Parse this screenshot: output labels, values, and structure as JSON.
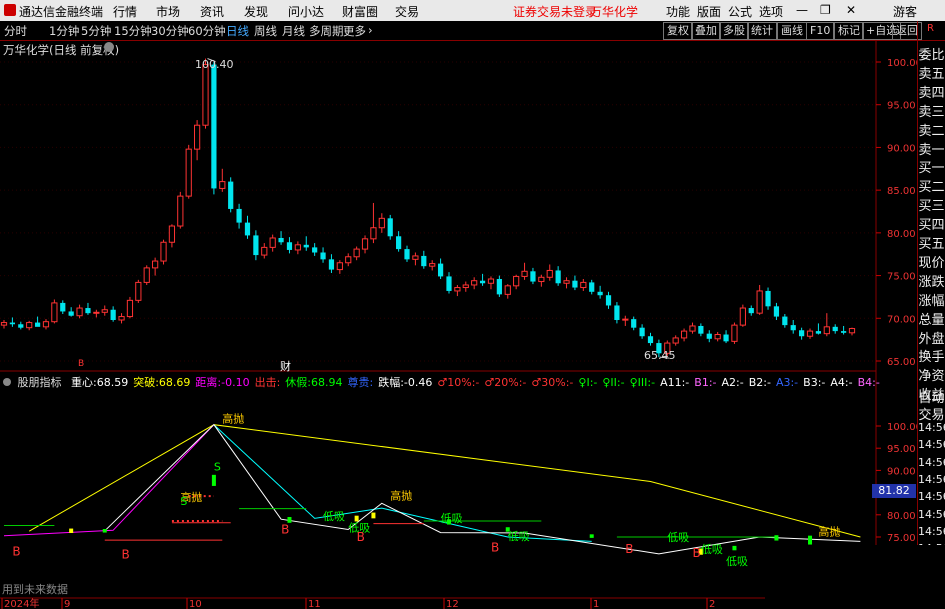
{
  "titlebar": {
    "app_name": "通达信金融终端",
    "menus": [
      "行情",
      "市场",
      "资讯",
      "发现",
      "问小达",
      "财富圈",
      "交易"
    ],
    "login_notice": "证券交易未登录",
    "stock_name": "万华化学",
    "right_menus": [
      "功能",
      "版面",
      "公式",
      "选项"
    ],
    "guest": "游客"
  },
  "tabbar": {
    "periods": [
      "分时",
      "1分钟",
      "5分钟",
      "15分钟",
      "30分钟",
      "60分钟",
      "日线",
      "周线",
      "月线",
      "多周期",
      "更多"
    ],
    "active_period": "日线",
    "buttons": [
      "复权",
      "叠加",
      "多股",
      "统计",
      "画线",
      "F10",
      "标记",
      "+自选",
      "返回"
    ]
  },
  "main_chart": {
    "title": "万华化学(日线 前复权)",
    "high_label": "100.40",
    "low_label": "65.45",
    "marker_cai": "财",
    "marker_b": "B"
  },
  "sub_chart": {
    "title": "股朋指标",
    "fields": [
      {
        "label": "重心:",
        "value": "68.59",
        "color": "#ffffff"
      },
      {
        "label": "突破:",
        "value": "68.69",
        "color": "#ffff00"
      },
      {
        "label": "距离:",
        "value": "-0.10",
        "color": "#ff00ff"
      },
      {
        "label": "出击:",
        "value": "",
        "color": "#ff3333"
      },
      {
        "label": "休假:",
        "value": "68.94",
        "color": "#00ff00"
      },
      {
        "label": "尊贵:",
        "value": "",
        "color": "#3366ff"
      },
      {
        "label": "跌幅:",
        "value": "-0.46",
        "color": "#ffffff"
      },
      {
        "label": "♂10%:",
        "value": "-",
        "color": "#ff3333"
      },
      {
        "label": "♂20%:",
        "value": "-",
        "color": "#ff3333"
      },
      {
        "label": "♂30%:",
        "value": "-",
        "color": "#ff3333"
      },
      {
        "label": "♀I:",
        "value": "-",
        "color": "#00ff00"
      },
      {
        "label": "♀II:",
        "value": "-",
        "color": "#00ff00"
      },
      {
        "label": "♀III:",
        "value": "-",
        "color": "#00ff00"
      },
      {
        "label": "A11:",
        "value": "-",
        "color": "#ffffff"
      },
      {
        "label": "B1:",
        "value": "-",
        "color": "#ff66ff"
      },
      {
        "label": "A2:",
        "value": "-",
        "color": "#ffffff"
      },
      {
        "label": "B2:",
        "value": "-",
        "color": "#ffffff"
      },
      {
        "label": "A3:",
        "value": "-",
        "color": "#3366ff"
      },
      {
        "label": "B3:",
        "value": "-",
        "color": "#ffffff"
      },
      {
        "label": "A4:",
        "value": "-",
        "color": "#ffffff"
      },
      {
        "label": "B4:",
        "value": "-",
        "color": "#ff66ff"
      }
    ],
    "current_value": "81.82",
    "footer_note": "用到未来数据",
    "annotations": {
      "high_sell": "高抛",
      "low_buy": "低吸",
      "buy": "B",
      "sell": "S"
    }
  },
  "right_panel": {
    "items": [
      "委比",
      "卖五",
      "卖四",
      "卖三",
      "卖二",
      "卖一",
      "买一",
      "买二",
      "买三",
      "买四",
      "买五",
      "现价",
      "涨跌",
      "涨幅",
      "总量",
      "外盘",
      "换手",
      "净资",
      "收益"
    ],
    "lower_items": [
      "自动",
      "交易"
    ],
    "times": [
      "14:56",
      "14:56",
      "14:56",
      "14:56",
      "14:56",
      "14:56",
      "14:56",
      "14:56",
      "14:56",
      "14:56"
    ],
    "top_badge": "R"
  },
  "chart_data": [
    {
      "type": "candlestick",
      "title": "万华化学(日线 前复权)",
      "ylim": [
        64,
        101
      ],
      "y_ticks": [
        65.0,
        70.0,
        75.0,
        80.0,
        85.0,
        90.0,
        95.0,
        100.0
      ],
      "annotated_high": 100.4,
      "annotated_low": 65.45,
      "ohlc": [
        [
          69.2,
          69.8,
          68.8,
          69.5
        ],
        [
          69.5,
          70.1,
          69.0,
          69.3
        ],
        [
          69.3,
          69.6,
          68.7,
          68.9
        ],
        [
          68.9,
          69.7,
          68.6,
          69.5
        ],
        [
          69.5,
          70.2,
          69.1,
          69.0
        ],
        [
          69.0,
          69.9,
          68.7,
          69.6
        ],
        [
          69.6,
          72.2,
          69.4,
          71.8
        ],
        [
          71.8,
          72.1,
          70.5,
          70.8
        ],
        [
          70.8,
          71.3,
          70.2,
          70.3
        ],
        [
          70.3,
          71.6,
          70.0,
          71.2
        ],
        [
          71.2,
          71.8,
          70.4,
          70.6
        ],
        [
          70.6,
          71.0,
          70.1,
          70.7
        ],
        [
          70.7,
          71.5,
          70.3,
          71.0
        ],
        [
          71.0,
          71.4,
          69.6,
          69.8
        ],
        [
          69.8,
          70.6,
          69.4,
          70.2
        ],
        [
          70.2,
          72.5,
          70.0,
          72.1
        ],
        [
          72.1,
          74.5,
          71.8,
          74.2
        ],
        [
          74.2,
          76.2,
          73.9,
          75.9
        ],
        [
          75.9,
          77.1,
          75.0,
          76.7
        ],
        [
          76.7,
          79.2,
          76.3,
          78.9
        ],
        [
          78.9,
          81.0,
          78.3,
          80.8
        ],
        [
          80.8,
          84.8,
          80.5,
          84.3
        ],
        [
          84.3,
          90.3,
          84.0,
          89.8
        ],
        [
          89.8,
          93.2,
          88.5,
          92.6
        ],
        [
          92.6,
          100.4,
          92.2,
          99.7
        ],
        [
          99.7,
          100.0,
          84.5,
          85.2
        ],
        [
          85.2,
          87.5,
          84.8,
          86.0
        ],
        [
          86.0,
          86.5,
          82.4,
          82.8
        ],
        [
          82.8,
          83.4,
          80.5,
          81.2
        ],
        [
          81.2,
          82.0,
          79.3,
          79.7
        ],
        [
          79.7,
          80.3,
          76.8,
          77.4
        ],
        [
          77.4,
          78.8,
          77.0,
          78.3
        ],
        [
          78.3,
          79.8,
          77.8,
          79.4
        ],
        [
          79.4,
          80.2,
          78.6,
          78.9
        ],
        [
          78.9,
          79.5,
          77.6,
          78.0
        ],
        [
          78.0,
          79.0,
          77.5,
          78.6
        ],
        [
          78.6,
          79.6,
          77.9,
          78.3
        ],
        [
          78.3,
          78.8,
          77.3,
          77.7
        ],
        [
          77.7,
          78.3,
          76.5,
          76.9
        ],
        [
          76.9,
          77.5,
          75.3,
          75.7
        ],
        [
          75.7,
          76.8,
          75.2,
          76.5
        ],
        [
          76.5,
          77.6,
          76.1,
          77.2
        ],
        [
          77.2,
          78.4,
          76.8,
          78.1
        ],
        [
          78.1,
          79.7,
          77.6,
          79.3
        ],
        [
          79.3,
          83.5,
          78.8,
          80.6
        ],
        [
          80.6,
          82.3,
          80.0,
          81.7
        ],
        [
          81.7,
          82.1,
          79.2,
          79.6
        ],
        [
          79.6,
          80.2,
          77.8,
          78.1
        ],
        [
          78.1,
          78.5,
          76.6,
          76.9
        ],
        [
          76.9,
          77.7,
          76.2,
          77.3
        ],
        [
          77.3,
          77.9,
          75.8,
          76.1
        ],
        [
          76.1,
          76.8,
          75.6,
          76.4
        ],
        [
          76.4,
          77.0,
          74.6,
          74.9
        ],
        [
          74.9,
          75.4,
          72.9,
          73.2
        ],
        [
          73.2,
          73.9,
          72.6,
          73.6
        ],
        [
          73.6,
          74.3,
          73.1,
          73.9
        ],
        [
          73.9,
          74.8,
          73.4,
          74.4
        ],
        [
          74.4,
          75.2,
          73.8,
          74.1
        ],
        [
          74.1,
          74.9,
          73.4,
          74.6
        ],
        [
          74.6,
          75.0,
          72.5,
          72.8
        ],
        [
          72.8,
          74.0,
          72.3,
          73.8
        ],
        [
          73.8,
          75.1,
          73.4,
          74.9
        ],
        [
          74.9,
          76.5,
          74.5,
          75.5
        ],
        [
          75.5,
          75.9,
          74.0,
          74.3
        ],
        [
          74.3,
          75.1,
          73.7,
          74.8
        ],
        [
          74.8,
          76.3,
          74.4,
          75.6
        ],
        [
          75.6,
          76.1,
          73.8,
          74.1
        ],
        [
          74.1,
          74.8,
          73.5,
          74.4
        ],
        [
          74.4,
          75.0,
          73.3,
          73.6
        ],
        [
          73.6,
          74.6,
          73.2,
          74.2
        ],
        [
          74.2,
          74.5,
          72.8,
          73.1
        ],
        [
          73.1,
          73.8,
          72.3,
          72.7
        ],
        [
          72.7,
          73.1,
          71.1,
          71.5
        ],
        [
          71.5,
          71.9,
          69.4,
          69.8
        ],
        [
          69.8,
          70.3,
          69.1,
          69.9
        ],
        [
          69.9,
          70.2,
          68.6,
          68.9
        ],
        [
          68.9,
          69.3,
          67.6,
          67.9
        ],
        [
          67.9,
          68.3,
          66.8,
          67.1
        ],
        [
          67.1,
          67.5,
          65.45,
          65.9
        ],
        [
          65.9,
          67.4,
          65.6,
          67.1
        ],
        [
          67.1,
          68.0,
          66.8,
          67.7
        ],
        [
          67.7,
          68.8,
          67.3,
          68.5
        ],
        [
          68.5,
          69.5,
          68.2,
          69.1
        ],
        [
          69.1,
          69.4,
          67.9,
          68.2
        ],
        [
          68.2,
          68.6,
          67.2,
          67.6
        ],
        [
          67.6,
          68.4,
          67.3,
          68.1
        ],
        [
          68.1,
          68.6,
          67.1,
          67.3
        ],
        [
          67.3,
          69.5,
          67.0,
          69.2
        ],
        [
          69.2,
          71.6,
          69.0,
          71.2
        ],
        [
          71.2,
          71.5,
          70.3,
          70.6
        ],
        [
          70.6,
          73.9,
          70.4,
          73.2
        ],
        [
          73.2,
          73.6,
          71.0,
          71.4
        ],
        [
          71.4,
          71.8,
          69.8,
          70.2
        ],
        [
          70.2,
          70.5,
          68.9,
          69.2
        ],
        [
          69.2,
          69.8,
          68.2,
          68.6
        ],
        [
          68.6,
          68.9,
          67.5,
          67.9
        ],
        [
          67.9,
          68.8,
          67.6,
          68.5
        ],
        [
          68.5,
          69.4,
          68.1,
          68.2
        ],
        [
          68.2,
          70.6,
          67.9,
          69.0
        ],
        [
          69.0,
          69.3,
          68.2,
          68.5
        ],
        [
          68.5,
          69.1,
          68.1,
          68.3
        ],
        [
          68.3,
          68.9,
          68.0,
          68.8
        ]
      ]
    },
    {
      "type": "line",
      "title": "股朋指标",
      "ylim": [
        73,
        102
      ],
      "y_ticks": [
        75.0,
        80.0,
        85.0,
        90.0,
        95.0,
        100.0
      ],
      "x_tick_labels": [
        "2024年",
        "9",
        "10",
        "11",
        "12",
        "1",
        "2"
      ],
      "series": [
        {
          "name": "",
          "color": "#ffff00",
          "points": [
            [
              3,
              76.3
            ],
            [
              25,
              100.3
            ],
            [
              77,
              87.5
            ],
            [
              102,
              75.0
            ]
          ]
        },
        {
          "name": "",
          "color": "#ff00ff",
          "points": [
            [
              0,
              75.3
            ],
            [
              13,
              76.5
            ],
            [
              25,
              100.3
            ]
          ]
        },
        {
          "name": "",
          "color": "#00ffff",
          "points": [
            [
              25,
              100.3
            ],
            [
              37,
              79.2
            ],
            [
              45,
              81.5
            ],
            [
              60,
              75.0
            ],
            [
              70,
              74.0
            ]
          ]
        },
        {
          "name": "",
          "color": "#ffffff",
          "points": [
            [
              12,
              76.4
            ],
            [
              25,
              100.3
            ],
            [
              33,
              79.0
            ],
            [
              41,
              76.7
            ],
            [
              45,
              82.6
            ],
            [
              52,
              76.0
            ],
            [
              62,
              75.9
            ],
            [
              78,
              71.2
            ],
            [
              90,
              75.0
            ],
            [
              102,
              74.0
            ]
          ]
        }
      ]
    }
  ]
}
